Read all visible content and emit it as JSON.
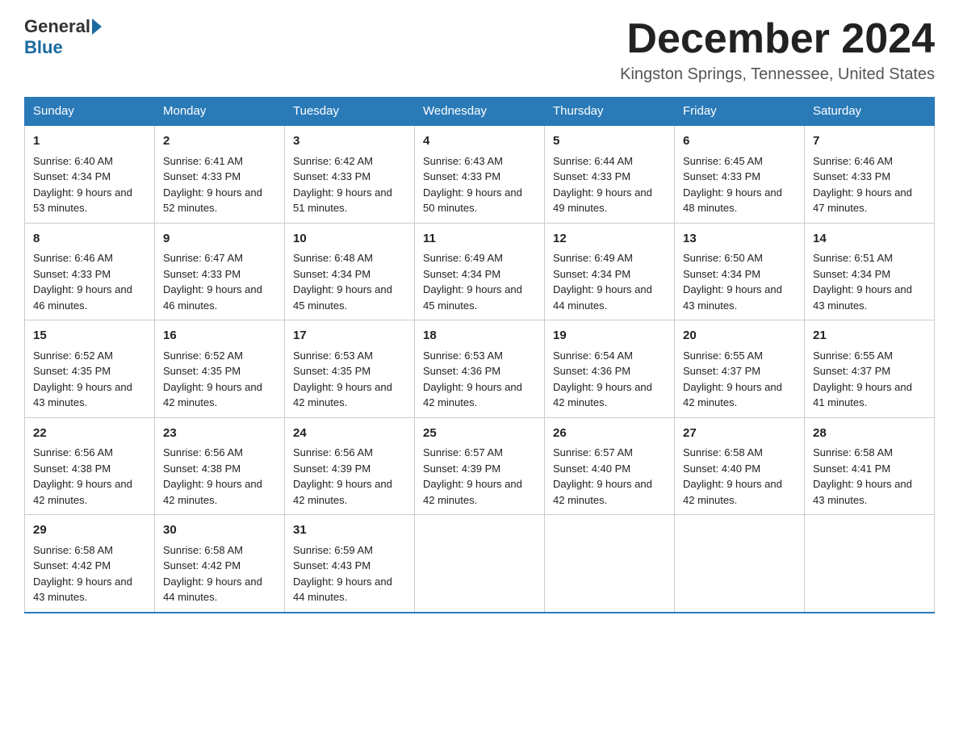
{
  "header": {
    "logo_text_general": "General",
    "logo_text_blue": "Blue",
    "month_title": "December 2024",
    "location": "Kingston Springs, Tennessee, United States"
  },
  "days_of_week": [
    "Sunday",
    "Monday",
    "Tuesday",
    "Wednesday",
    "Thursday",
    "Friday",
    "Saturday"
  ],
  "weeks": [
    [
      {
        "day": "1",
        "sunrise": "Sunrise: 6:40 AM",
        "sunset": "Sunset: 4:34 PM",
        "daylight": "Daylight: 9 hours and 53 minutes."
      },
      {
        "day": "2",
        "sunrise": "Sunrise: 6:41 AM",
        "sunset": "Sunset: 4:33 PM",
        "daylight": "Daylight: 9 hours and 52 minutes."
      },
      {
        "day": "3",
        "sunrise": "Sunrise: 6:42 AM",
        "sunset": "Sunset: 4:33 PM",
        "daylight": "Daylight: 9 hours and 51 minutes."
      },
      {
        "day": "4",
        "sunrise": "Sunrise: 6:43 AM",
        "sunset": "Sunset: 4:33 PM",
        "daylight": "Daylight: 9 hours and 50 minutes."
      },
      {
        "day": "5",
        "sunrise": "Sunrise: 6:44 AM",
        "sunset": "Sunset: 4:33 PM",
        "daylight": "Daylight: 9 hours and 49 minutes."
      },
      {
        "day": "6",
        "sunrise": "Sunrise: 6:45 AM",
        "sunset": "Sunset: 4:33 PM",
        "daylight": "Daylight: 9 hours and 48 minutes."
      },
      {
        "day": "7",
        "sunrise": "Sunrise: 6:46 AM",
        "sunset": "Sunset: 4:33 PM",
        "daylight": "Daylight: 9 hours and 47 minutes."
      }
    ],
    [
      {
        "day": "8",
        "sunrise": "Sunrise: 6:46 AM",
        "sunset": "Sunset: 4:33 PM",
        "daylight": "Daylight: 9 hours and 46 minutes."
      },
      {
        "day": "9",
        "sunrise": "Sunrise: 6:47 AM",
        "sunset": "Sunset: 4:33 PM",
        "daylight": "Daylight: 9 hours and 46 minutes."
      },
      {
        "day": "10",
        "sunrise": "Sunrise: 6:48 AM",
        "sunset": "Sunset: 4:34 PM",
        "daylight": "Daylight: 9 hours and 45 minutes."
      },
      {
        "day": "11",
        "sunrise": "Sunrise: 6:49 AM",
        "sunset": "Sunset: 4:34 PM",
        "daylight": "Daylight: 9 hours and 45 minutes."
      },
      {
        "day": "12",
        "sunrise": "Sunrise: 6:49 AM",
        "sunset": "Sunset: 4:34 PM",
        "daylight": "Daylight: 9 hours and 44 minutes."
      },
      {
        "day": "13",
        "sunrise": "Sunrise: 6:50 AM",
        "sunset": "Sunset: 4:34 PM",
        "daylight": "Daylight: 9 hours and 43 minutes."
      },
      {
        "day": "14",
        "sunrise": "Sunrise: 6:51 AM",
        "sunset": "Sunset: 4:34 PM",
        "daylight": "Daylight: 9 hours and 43 minutes."
      }
    ],
    [
      {
        "day": "15",
        "sunrise": "Sunrise: 6:52 AM",
        "sunset": "Sunset: 4:35 PM",
        "daylight": "Daylight: 9 hours and 43 minutes."
      },
      {
        "day": "16",
        "sunrise": "Sunrise: 6:52 AM",
        "sunset": "Sunset: 4:35 PM",
        "daylight": "Daylight: 9 hours and 42 minutes."
      },
      {
        "day": "17",
        "sunrise": "Sunrise: 6:53 AM",
        "sunset": "Sunset: 4:35 PM",
        "daylight": "Daylight: 9 hours and 42 minutes."
      },
      {
        "day": "18",
        "sunrise": "Sunrise: 6:53 AM",
        "sunset": "Sunset: 4:36 PM",
        "daylight": "Daylight: 9 hours and 42 minutes."
      },
      {
        "day": "19",
        "sunrise": "Sunrise: 6:54 AM",
        "sunset": "Sunset: 4:36 PM",
        "daylight": "Daylight: 9 hours and 42 minutes."
      },
      {
        "day": "20",
        "sunrise": "Sunrise: 6:55 AM",
        "sunset": "Sunset: 4:37 PM",
        "daylight": "Daylight: 9 hours and 42 minutes."
      },
      {
        "day": "21",
        "sunrise": "Sunrise: 6:55 AM",
        "sunset": "Sunset: 4:37 PM",
        "daylight": "Daylight: 9 hours and 41 minutes."
      }
    ],
    [
      {
        "day": "22",
        "sunrise": "Sunrise: 6:56 AM",
        "sunset": "Sunset: 4:38 PM",
        "daylight": "Daylight: 9 hours and 42 minutes."
      },
      {
        "day": "23",
        "sunrise": "Sunrise: 6:56 AM",
        "sunset": "Sunset: 4:38 PM",
        "daylight": "Daylight: 9 hours and 42 minutes."
      },
      {
        "day": "24",
        "sunrise": "Sunrise: 6:56 AM",
        "sunset": "Sunset: 4:39 PM",
        "daylight": "Daylight: 9 hours and 42 minutes."
      },
      {
        "day": "25",
        "sunrise": "Sunrise: 6:57 AM",
        "sunset": "Sunset: 4:39 PM",
        "daylight": "Daylight: 9 hours and 42 minutes."
      },
      {
        "day": "26",
        "sunrise": "Sunrise: 6:57 AM",
        "sunset": "Sunset: 4:40 PM",
        "daylight": "Daylight: 9 hours and 42 minutes."
      },
      {
        "day": "27",
        "sunrise": "Sunrise: 6:58 AM",
        "sunset": "Sunset: 4:40 PM",
        "daylight": "Daylight: 9 hours and 42 minutes."
      },
      {
        "day": "28",
        "sunrise": "Sunrise: 6:58 AM",
        "sunset": "Sunset: 4:41 PM",
        "daylight": "Daylight: 9 hours and 43 minutes."
      }
    ],
    [
      {
        "day": "29",
        "sunrise": "Sunrise: 6:58 AM",
        "sunset": "Sunset: 4:42 PM",
        "daylight": "Daylight: 9 hours and 43 minutes."
      },
      {
        "day": "30",
        "sunrise": "Sunrise: 6:58 AM",
        "sunset": "Sunset: 4:42 PM",
        "daylight": "Daylight: 9 hours and 44 minutes."
      },
      {
        "day": "31",
        "sunrise": "Sunrise: 6:59 AM",
        "sunset": "Sunset: 4:43 PM",
        "daylight": "Daylight: 9 hours and 44 minutes."
      },
      null,
      null,
      null,
      null
    ]
  ]
}
